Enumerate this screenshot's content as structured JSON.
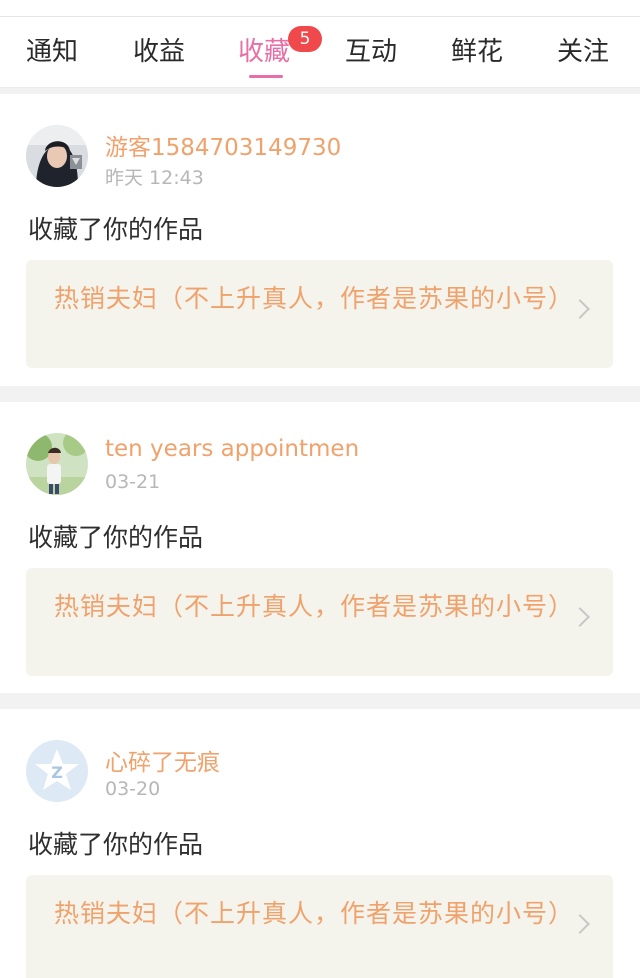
{
  "tabs": [
    {
      "label": "通知",
      "active": false
    },
    {
      "label": "收益",
      "active": false
    },
    {
      "label": "收藏",
      "active": true,
      "badge": "5"
    },
    {
      "label": "互动",
      "active": false
    },
    {
      "label": "鲜花",
      "active": false
    },
    {
      "label": "关注",
      "active": false
    }
  ],
  "colors": {
    "accent": "#e86fa6",
    "username": "#f0a26c",
    "badge": "#f0494b",
    "work_box_bg": "#f4f3ec"
  },
  "notifications": [
    {
      "username": "游客1584703149730",
      "time": "昨天 12:43",
      "action": "收藏了你的作品",
      "work_title": "热销夫妇（不上升真人，作者是苏果的小号）",
      "avatar": "dark-hair-girl-avatar"
    },
    {
      "username": "ten years appointmen",
      "time": "03-21",
      "action": "收藏了你的作品",
      "work_title": "热销夫妇（不上升真人，作者是苏果的小号）",
      "avatar": "outdoor-person-avatar"
    },
    {
      "username": "心碎了无痕",
      "time": "03-20",
      "action": "收藏了你的作品",
      "work_title": "热销夫妇（不上升真人，作者是苏果的小号）",
      "avatar": "default-star-avatar"
    }
  ]
}
